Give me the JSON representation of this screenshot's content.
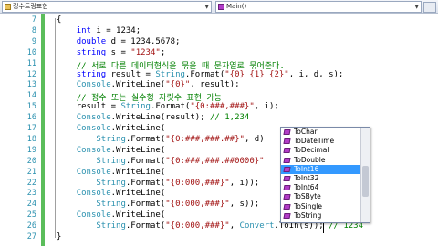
{
  "nav": {
    "left_dropdown": "정수트링표현",
    "right_dropdown": "Main()"
  },
  "line_numbers": [
    "7",
    "8",
    "9",
    "10",
    "11",
    "12",
    "13",
    "14",
    "15",
    "16",
    "17",
    "18",
    "19",
    "20",
    "21",
    "22",
    "23",
    "24",
    "25",
    "26",
    "27"
  ],
  "code_lines": [
    [
      {
        "t": "{",
        "c": ""
      }
    ],
    [
      {
        "t": "    ",
        "c": ""
      },
      {
        "t": "int",
        "c": "kw"
      },
      {
        "t": " i = 1234;",
        "c": ""
      }
    ],
    [
      {
        "t": "    ",
        "c": ""
      },
      {
        "t": "double",
        "c": "kw"
      },
      {
        "t": " d = 1234.5678;",
        "c": ""
      }
    ],
    [
      {
        "t": "    ",
        "c": ""
      },
      {
        "t": "string",
        "c": "kw"
      },
      {
        "t": " s = ",
        "c": ""
      },
      {
        "t": "\"1234\"",
        "c": "str"
      },
      {
        "t": ";",
        "c": ""
      }
    ],
    [
      {
        "t": "    ",
        "c": ""
      },
      {
        "t": "// 서로 다른 데이터형식을 묶을 때 문자열로 묶어준다.",
        "c": "cmt"
      }
    ],
    [
      {
        "t": "    ",
        "c": ""
      },
      {
        "t": "string",
        "c": "kw"
      },
      {
        "t": " result = ",
        "c": ""
      },
      {
        "t": "String",
        "c": "typ"
      },
      {
        "t": ".Format(",
        "c": ""
      },
      {
        "t": "\"{0} {1} {2}\"",
        "c": "str"
      },
      {
        "t": ", i, d, s);",
        "c": ""
      }
    ],
    [
      {
        "t": "    ",
        "c": ""
      },
      {
        "t": "Console",
        "c": "typ"
      },
      {
        "t": ".WriteLine(",
        "c": ""
      },
      {
        "t": "\"{0}\"",
        "c": "str"
      },
      {
        "t": ", result);",
        "c": ""
      }
    ],
    [
      {
        "t": "    ",
        "c": ""
      },
      {
        "t": "// 정수 또는 실수형 자릿수 표현 가능",
        "c": "cmt"
      }
    ],
    [
      {
        "t": "    result = ",
        "c": ""
      },
      {
        "t": "String",
        "c": "typ"
      },
      {
        "t": ".Format(",
        "c": ""
      },
      {
        "t": "\"{0:###,###}\"",
        "c": "str"
      },
      {
        "t": ", i);",
        "c": ""
      }
    ],
    [
      {
        "t": "    ",
        "c": ""
      },
      {
        "t": "Console",
        "c": "typ"
      },
      {
        "t": ".WriteLine(result); ",
        "c": ""
      },
      {
        "t": "// 1,234",
        "c": "cmt"
      }
    ],
    [
      {
        "t": "    ",
        "c": ""
      },
      {
        "t": "Console",
        "c": "typ"
      },
      {
        "t": ".WriteLine(",
        "c": ""
      }
    ],
    [
      {
        "t": "        ",
        "c": ""
      },
      {
        "t": "String",
        "c": "typ"
      },
      {
        "t": ".Format(",
        "c": ""
      },
      {
        "t": "\"{0:###,###.##}\"",
        "c": "str"
      },
      {
        "t": ", d)",
        "c": ""
      }
    ],
    [
      {
        "t": "    ",
        "c": ""
      },
      {
        "t": "Console",
        "c": "typ"
      },
      {
        "t": ".WriteLine(",
        "c": ""
      }
    ],
    [
      {
        "t": "        ",
        "c": ""
      },
      {
        "t": "String",
        "c": "typ"
      },
      {
        "t": ".Format(",
        "c": ""
      },
      {
        "t": "\"{0:###,###.##0000}\"",
        "c": "str"
      },
      {
        "t": "                 ",
        "c": ""
      },
      {
        "t": "800",
        "c": "cmt"
      }
    ],
    [
      {
        "t": "    ",
        "c": ""
      },
      {
        "t": "Console",
        "c": "typ"
      },
      {
        "t": ".WriteLine(",
        "c": ""
      }
    ],
    [
      {
        "t": "        ",
        "c": ""
      },
      {
        "t": "String",
        "c": "typ"
      },
      {
        "t": ".Format(",
        "c": ""
      },
      {
        "t": "\"{0:000,###}\"",
        "c": "str"
      },
      {
        "t": ", i));",
        "c": ""
      }
    ],
    [
      {
        "t": "    ",
        "c": ""
      },
      {
        "t": "Console",
        "c": "typ"
      },
      {
        "t": ".WriteLine(",
        "c": ""
      }
    ],
    [
      {
        "t": "        ",
        "c": ""
      },
      {
        "t": "String",
        "c": "typ"
      },
      {
        "t": ".Format(",
        "c": ""
      },
      {
        "t": "\"{0:000,###}\"",
        "c": "str"
      },
      {
        "t": ", s));",
        "c": ""
      }
    ],
    [
      {
        "t": "    ",
        "c": ""
      },
      {
        "t": "Console",
        "c": "typ"
      },
      {
        "t": ".WriteLine(",
        "c": ""
      }
    ],
    [
      {
        "t": "        ",
        "c": ""
      },
      {
        "t": "String",
        "c": "typ"
      },
      {
        "t": ".Format(",
        "c": ""
      },
      {
        "t": "\"{0:000,###}\"",
        "c": "str"
      },
      {
        "t": ", ",
        "c": ""
      },
      {
        "t": "Convert",
        "c": "typ"
      },
      {
        "t": ".ToIn(s)); ",
        "c": ""
      },
      {
        "t": "// 1234",
        "c": "cmt"
      }
    ],
    [
      {
        "t": "}",
        "c": ""
      }
    ]
  ],
  "intellisense": {
    "items": [
      "ToChar",
      "ToDateTime",
      "ToDecimal",
      "ToDouble",
      "ToInt16",
      "ToInt32",
      "ToInt64",
      "ToSByte",
      "ToSingle",
      "ToString"
    ],
    "selected_index": 4
  }
}
